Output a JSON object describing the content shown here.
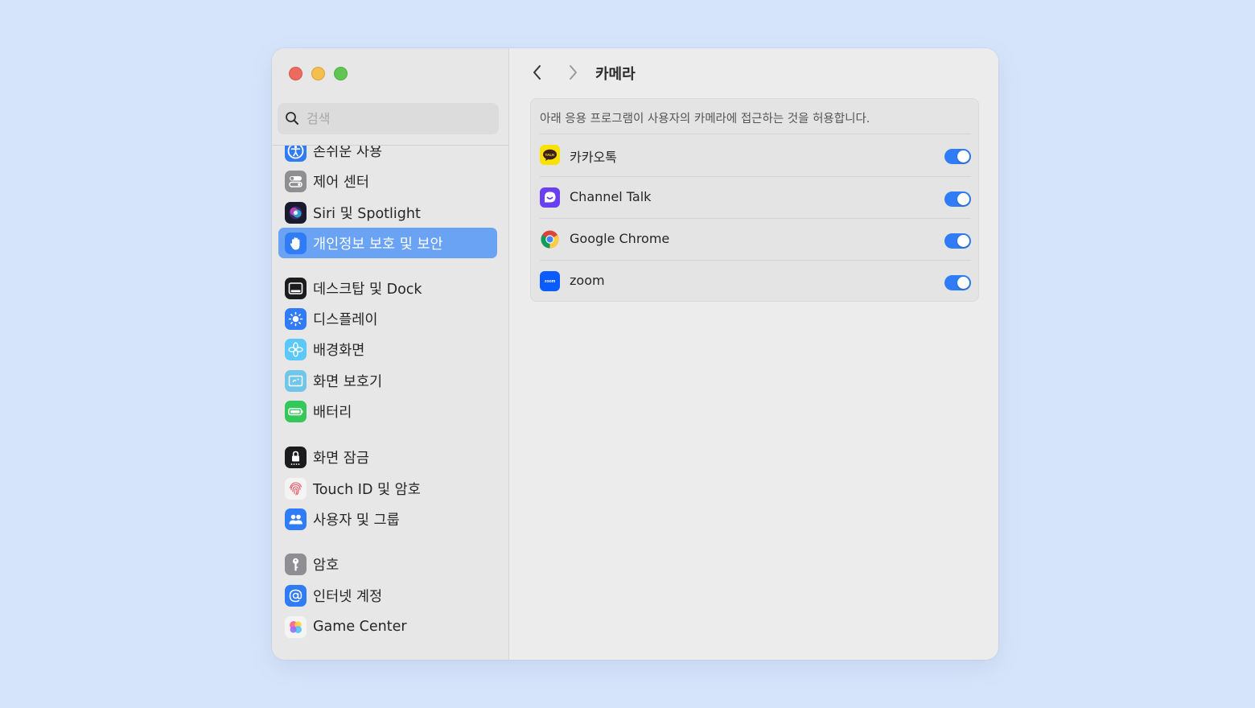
{
  "window": {
    "search": {
      "placeholder": "검색",
      "value": ""
    },
    "sidebar": {
      "items": [
        {
          "label": "손쉬운 사용",
          "icon": "accessibility-icon"
        },
        {
          "label": "제어 센터",
          "icon": "control-center-icon"
        },
        {
          "label": "Siri 및 Spotlight",
          "icon": "siri-icon"
        },
        {
          "label": "개인정보 보호 및 보안",
          "icon": "hand-icon",
          "selected": true
        },
        {
          "label": "데스크탑 및 Dock",
          "icon": "dock-icon"
        },
        {
          "label": "디스플레이",
          "icon": "display-brightness-icon"
        },
        {
          "label": "배경화면",
          "icon": "wallpaper-flower-icon"
        },
        {
          "label": "화면 보호기",
          "icon": "screensaver-icon"
        },
        {
          "label": "배터리",
          "icon": "battery-icon"
        },
        {
          "label": "화면 잠금",
          "icon": "lock-icon"
        },
        {
          "label": "Touch ID 및 암호",
          "icon": "fingerprint-icon"
        },
        {
          "label": "사용자 및 그룹",
          "icon": "users-icon"
        },
        {
          "label": "암호",
          "icon": "key-icon"
        },
        {
          "label": "인터넷 계정",
          "icon": "at-sign-icon"
        },
        {
          "label": "Game Center",
          "icon": "game-center-icon"
        }
      ]
    },
    "main": {
      "title": "카메라",
      "description": "아래 응용 프로그램이 사용자의 카메라에 접근하는 것을 허용합니다.",
      "apps": [
        {
          "name": "카카오톡",
          "icon": "kakaotalk-icon",
          "icon_text": "TALK",
          "enabled": true
        },
        {
          "name": "Channel Talk",
          "icon": "channel-talk-icon",
          "enabled": true
        },
        {
          "name": "Google Chrome",
          "icon": "chrome-icon",
          "enabled": true
        },
        {
          "name": "zoom",
          "icon": "zoom-icon",
          "icon_text": "zoom",
          "enabled": true
        }
      ]
    }
  },
  "colors": {
    "background": "#d6e4fb",
    "accent": "#2f7cf6",
    "selection": "#6aa2f4"
  }
}
